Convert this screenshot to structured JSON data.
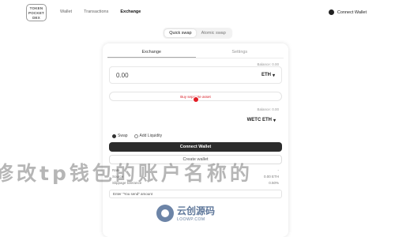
{
  "logo": {
    "lines": [
      "TOKEN",
      "POCKET",
      "DEX"
    ]
  },
  "nav": [
    {
      "label": "Wallet"
    },
    {
      "label": "Transactions"
    },
    {
      "label": "Exchange"
    }
  ],
  "network": {
    "label": "Connect Wallet"
  },
  "modes": [
    {
      "label": "Quick swap"
    },
    {
      "label": "Atomic swap"
    }
  ],
  "tabs": [
    {
      "label": "Exchange"
    },
    {
      "label": "Settings"
    }
  ],
  "from": {
    "balance": "Balance: 0.00",
    "amount": "0.00",
    "token": "ETH"
  },
  "buy_button": "Buy separate asset",
  "to": {
    "balance": "Balance: 0.00",
    "amount": "",
    "token": "WETC ETH"
  },
  "options": [
    {
      "label": "Swap",
      "selected": true
    },
    {
      "label": "Add Liquidity",
      "selected": false
    }
  ],
  "connect_button": "Connect Wallet",
  "create_button": "Create wallet",
  "info": [
    {
      "label": "Rate",
      "value": "-"
    },
    {
      "label": "Source",
      "value": "0.00 ETH"
    },
    {
      "label": "Slippage tolerance",
      "value": "0.50%"
    }
  ],
  "address_placeholder": "Enter \"You send\" amount",
  "watermark": {
    "title": "修改tp钱包的账户名称的",
    "brand_cn": "云创源码",
    "brand_en": "LOOWP.COM"
  },
  "colors": {
    "accent": "#e21c24",
    "primary_button": "#2c2c2c",
    "brand": "#2b4c7a"
  }
}
